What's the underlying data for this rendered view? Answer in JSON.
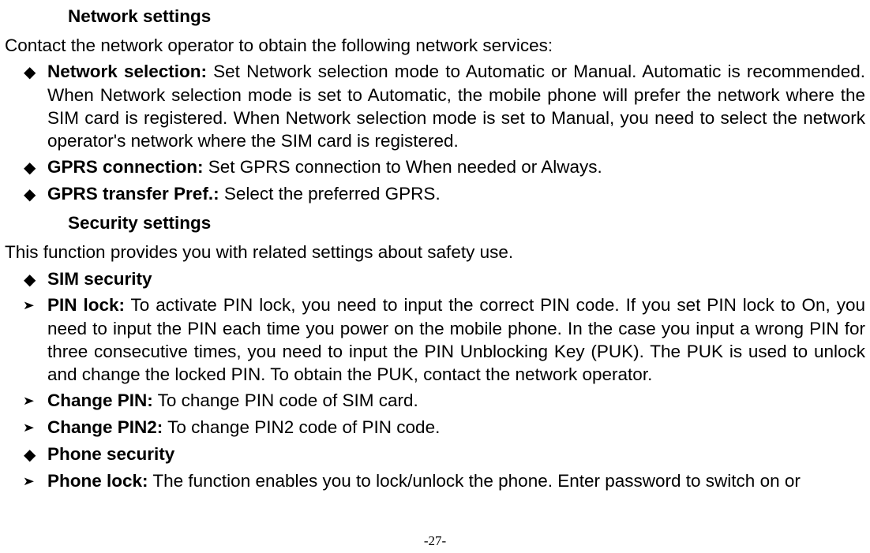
{
  "sections": {
    "network": {
      "title": "Network settings",
      "intro": "Contact the network operator to obtain the following network services:",
      "items": [
        {
          "label": "Network selection:",
          "text": " Set Network selection mode to Automatic or Manual. Automatic is recommended. When Network selection mode is set to Automatic, the mobile phone will prefer the network where the SIM card is registered. When Network selection mode is set to Manual, you need to select the network operator's network where the SIM card is registered.",
          "justify": true
        },
        {
          "label": "GPRS connection:",
          "text": " Set GPRS connection to When needed or Always.",
          "justify": false
        },
        {
          "label": "GPRS transfer Pref.:",
          "text": " Select the preferred GPRS.",
          "justify": false
        }
      ]
    },
    "security": {
      "title": "Security settings",
      "intro": "This function provides you with related settings about safety use.",
      "items": [
        {
          "type": "diamond",
          "label": "SIM security",
          "text": "",
          "justify": false
        },
        {
          "type": "arrow",
          "label": "PIN lock:",
          "text": " To activate PIN lock, you need to input the correct PIN code. If you set PIN lock to On, you need to input the PIN each time you power on the mobile phone. In the case you input a wrong PIN for three consecutive times, you need to input the PIN Unblocking Key (PUK). The PUK is used to unlock and change the locked PIN. To obtain the PUK, contact the network operator.",
          "justify": true
        },
        {
          "type": "arrow",
          "label": "Change PIN:",
          "text": " To change PIN code of SIM card.",
          "justify": false
        },
        {
          "type": "arrow",
          "label": "Change PIN2:",
          "text": " To change PIN2 code of PIN code.",
          "justify": false
        },
        {
          "type": "diamond",
          "label": "Phone security",
          "text": "",
          "justify": false
        },
        {
          "type": "arrow",
          "label": "Phone lock:",
          "text": " The function enables you to lock/unlock the phone. Enter password to switch on or",
          "justify": true
        }
      ]
    }
  },
  "footer": "-27-"
}
